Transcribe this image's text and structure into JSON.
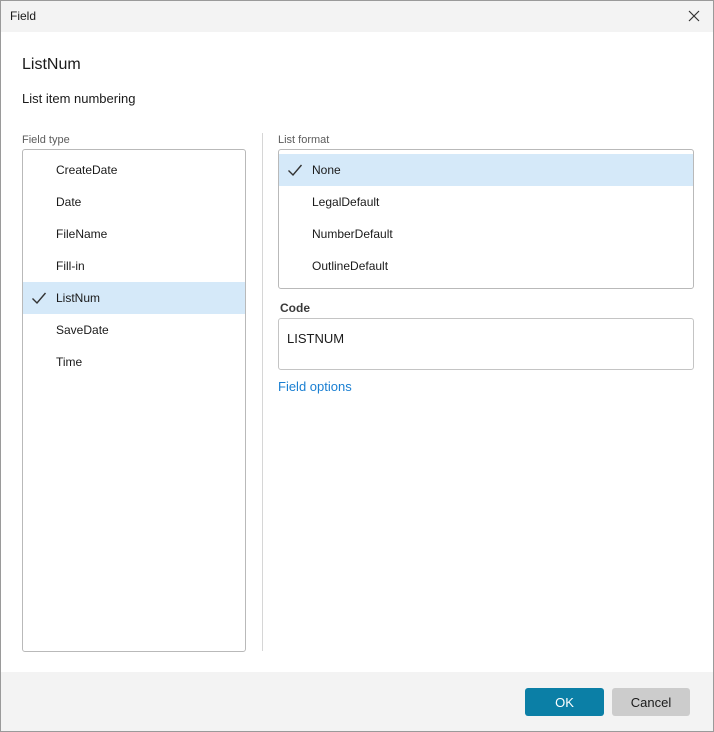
{
  "window": {
    "title": "Field"
  },
  "header": {
    "title": "ListNum",
    "description": "List item numbering"
  },
  "field_type": {
    "label": "Field type",
    "items": [
      {
        "label": "CreateDate",
        "selected": false
      },
      {
        "label": "Date",
        "selected": false
      },
      {
        "label": "FileName",
        "selected": false
      },
      {
        "label": "Fill-in",
        "selected": false
      },
      {
        "label": "ListNum",
        "selected": true
      },
      {
        "label": "SaveDate",
        "selected": false
      },
      {
        "label": "Time",
        "selected": false
      }
    ]
  },
  "list_format": {
    "label": "List format",
    "items": [
      {
        "label": "None",
        "selected": true
      },
      {
        "label": "LegalDefault",
        "selected": false
      },
      {
        "label": "NumberDefault",
        "selected": false
      },
      {
        "label": "OutlineDefault",
        "selected": false
      }
    ]
  },
  "code": {
    "label": "Code",
    "value": "LISTNUM"
  },
  "links": {
    "field_options": "Field options"
  },
  "buttons": {
    "ok": "OK",
    "cancel": "Cancel"
  },
  "colors": {
    "accent": "#0b7fa6",
    "selection": "#d5e9f9",
    "link": "#1a7fd2"
  },
  "icons": {
    "close": "close-icon",
    "check": "checkmark-icon"
  }
}
